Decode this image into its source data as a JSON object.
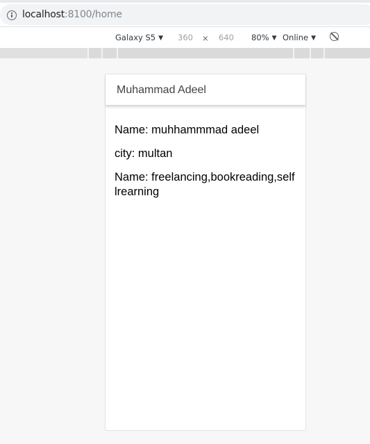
{
  "browser": {
    "url_host": "localhost",
    "url_rest": ":8100/home"
  },
  "device_toolbar": {
    "device": "Galaxy S5",
    "width": "360",
    "separator": "×",
    "height": "640",
    "zoom": "80%",
    "throttling": "Online",
    "caret": "▼"
  },
  "app": {
    "title": "Muhammad Adeel",
    "lines": [
      "Name: muhhammmad adeel",
      "city: multan",
      "Name: freelancing,bookreading,selflrearning"
    ]
  },
  "icons": {
    "info": "info-icon",
    "rotate": "rotate-icon"
  }
}
